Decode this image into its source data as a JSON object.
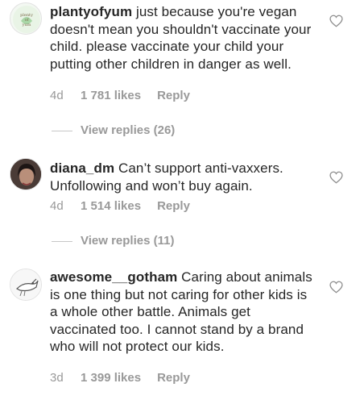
{
  "comments": [
    {
      "username": "plantyofyum",
      "text": " just because you're vegan doesn't mean you shouldn't vaccinate your child. please vaccinate your child your putting other children in danger as well.",
      "age": "4d",
      "likes": "1 781 likes",
      "reply": "Reply",
      "view_replies": "View replies (26)",
      "avatar_icon": "plant-logo-icon"
    },
    {
      "username": "diana_dm",
      "text": " Can’t support anti-vaxxers. Unfollowing and won’t buy again.",
      "age": "4d",
      "likes": "1 514 likes",
      "reply": "Reply",
      "view_replies": "View replies (11)",
      "avatar_icon": "profile-photo-icon"
    },
    {
      "username": "awesome__gotham",
      "text": " Caring about animals is one thing but not caring for other kids is a whole other battle. Animals get vaccinated too. I cannot stand by a brand who will not protect our kids.",
      "age": "3d",
      "likes": "1 399 likes",
      "reply": "Reply",
      "avatar_icon": "bird-sketch-icon"
    }
  ],
  "colors": {
    "text": "#262626",
    "muted": "#999999",
    "divider": "#c7c7c7"
  }
}
